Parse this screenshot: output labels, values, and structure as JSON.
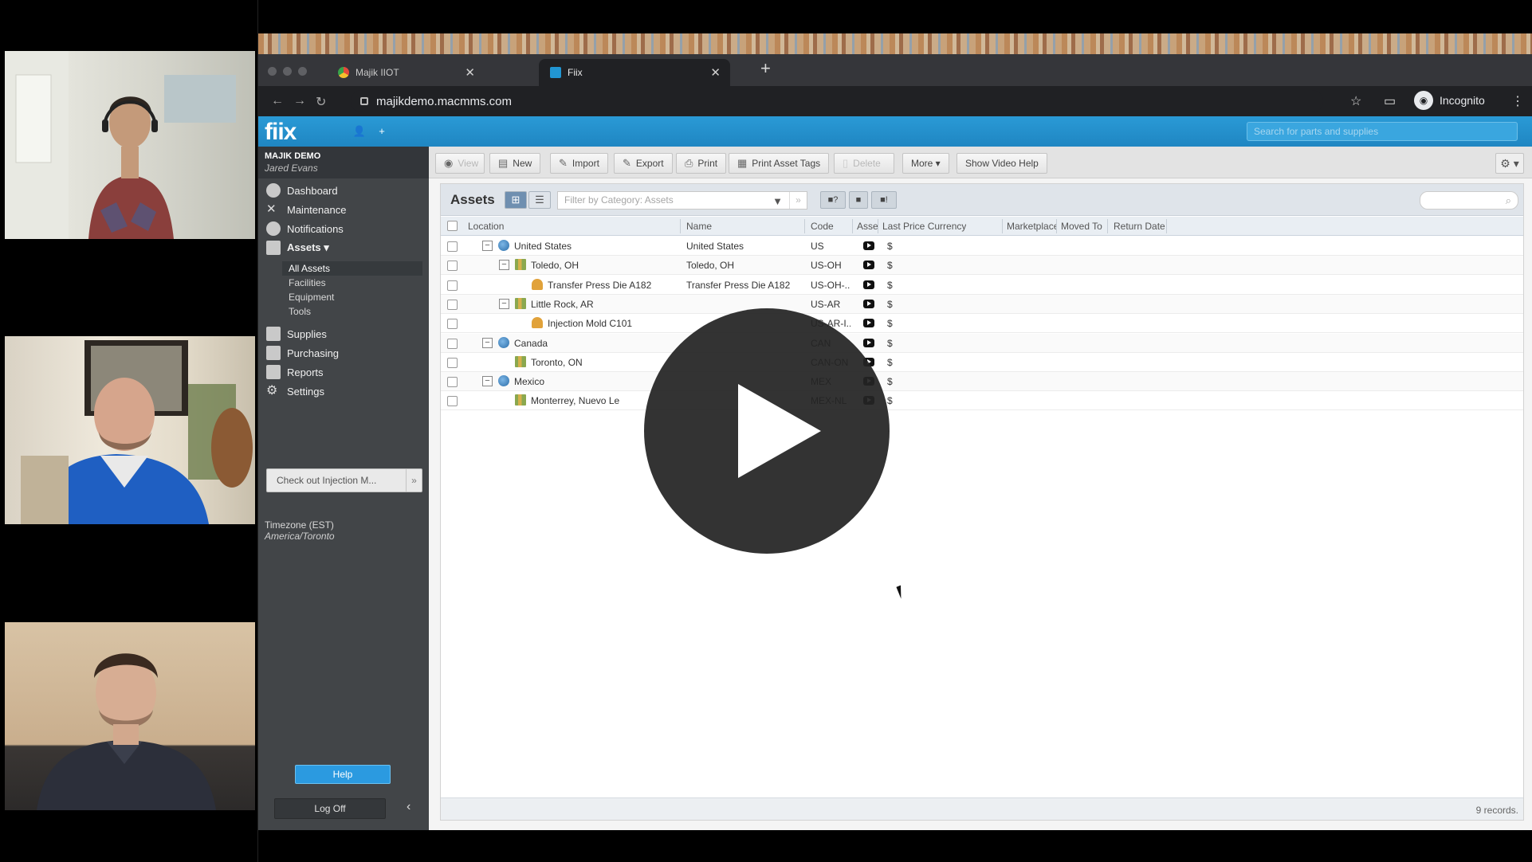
{
  "browser": {
    "tabs": [
      {
        "label": "Majik IIOT"
      },
      {
        "label": "Fiix"
      }
    ],
    "url": "majikdemo.macmms.com",
    "profile_label": "Incognito"
  },
  "app": {
    "logo": "fiix",
    "global_search_placeholder": "Search for parts and supplies",
    "account": {
      "org": "MAJIK DEMO",
      "user": "Jared Evans"
    },
    "menu": [
      {
        "label": "Dashboard"
      },
      {
        "label": "Maintenance"
      },
      {
        "label": "Notifications"
      },
      {
        "label": "Assets ▾"
      },
      {
        "label": "Supplies"
      },
      {
        "label": "Purchasing"
      },
      {
        "label": "Reports"
      },
      {
        "label": "Settings"
      }
    ],
    "assets_submenu": [
      {
        "label": "All Assets"
      },
      {
        "label": "Facilities"
      },
      {
        "label": "Equipment"
      },
      {
        "label": "Tools"
      }
    ],
    "checkout_label": "Check out Injection M...",
    "timezone_label": "Timezone (EST)",
    "timezone_location": "America/Toronto",
    "help_label": "Help",
    "logoff_label": "Log Off",
    "toolbar": {
      "view": "View",
      "new": "New",
      "import": "Import",
      "export": "Export",
      "print": "Print",
      "print_tags": "Print Asset Tags",
      "delete": "Delete",
      "more": "More ▾",
      "video_help": "Show Video Help"
    },
    "panel": {
      "title": "Assets",
      "filter_placeholder": "Filter by Category: Assets",
      "columns": [
        "Location",
        "Name",
        "Code",
        "Asset",
        "Last Price Currency",
        "Marketplace",
        "Moved To",
        "Return Date"
      ],
      "rows": [
        {
          "location": "United States",
          "name": "United States",
          "code": "US",
          "currency": "$",
          "level": 0,
          "type": "globe",
          "toggle": "−"
        },
        {
          "location": "Toledo, OH",
          "name": "Toledo, OH",
          "code": "US-OH",
          "currency": "$",
          "level": 1,
          "type": "bldg",
          "toggle": "−"
        },
        {
          "location": "Transfer Press Die A182",
          "name": "Transfer Press Die A182",
          "code": "US-OH-...",
          "currency": "$",
          "level": 2,
          "type": "bell",
          "toggle": ""
        },
        {
          "location": "Little Rock, AR",
          "name": "",
          "code": "US-AR",
          "currency": "$",
          "level": 1,
          "type": "bldg",
          "toggle": "−"
        },
        {
          "location": "Injection Mold C101",
          "name": "",
          "code": "US-AR-I...",
          "currency": "$",
          "level": 2,
          "type": "bell",
          "toggle": ""
        },
        {
          "location": "Canada",
          "name": "",
          "code": "CAN",
          "currency": "$",
          "level": 0,
          "type": "globe",
          "toggle": "−"
        },
        {
          "location": "Toronto, ON",
          "name": "",
          "code": "CAN-ON",
          "currency": "$",
          "level": 1,
          "type": "bldg",
          "toggle": ""
        },
        {
          "location": "Mexico",
          "name": "",
          "code": "MEX",
          "currency": "$",
          "level": 0,
          "type": "globe",
          "toggle": "−"
        },
        {
          "location": "Monterrey, Nuevo Le",
          "name": "",
          "code": "MEX-NL",
          "currency": "$",
          "level": 1,
          "type": "bldg",
          "toggle": ""
        }
      ],
      "records": "9 records."
    }
  },
  "colors": {
    "brand_blue": "#2196d3",
    "sidebar": "#424548"
  }
}
